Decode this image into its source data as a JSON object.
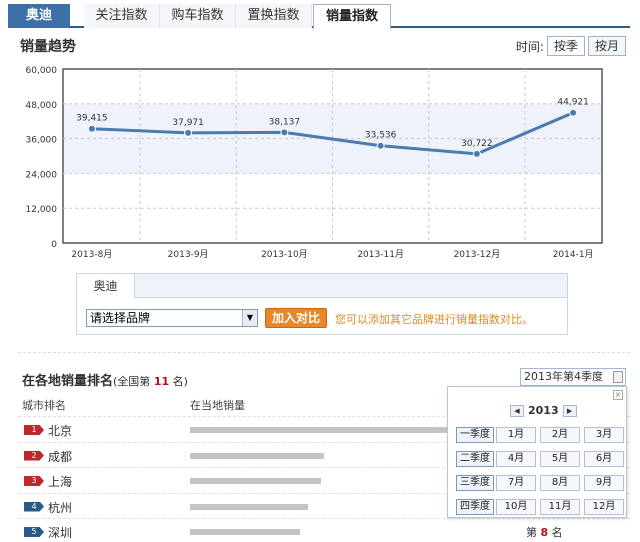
{
  "tabs": {
    "brand": "奥迪",
    "items": [
      "关注指数",
      "购车指数",
      "置换指数",
      "销量指数"
    ],
    "active_index": 3
  },
  "trend": {
    "title": "销量趋势",
    "time_label": "时间:",
    "by_quarter": "按季",
    "by_month": "按月"
  },
  "chart_data": {
    "type": "line",
    "categories": [
      "2013-8月",
      "2013-9月",
      "2013-10月",
      "2013-11月",
      "2013-12月",
      "2014-1月"
    ],
    "series": [
      {
        "values": [
          39415,
          37971,
          38137,
          33536,
          30722,
          44921
        ]
      }
    ],
    "data_labels": [
      "39,415",
      "37,971",
      "38,137",
      "33,536",
      "30,722",
      "44,921"
    ],
    "y_ticks": [
      "0",
      "12,000",
      "24,000",
      "36,000",
      "48,000",
      "60,000"
    ],
    "ylim": [
      0,
      60000
    ],
    "grid": true,
    "colors": {
      "line": "#4a7ab0",
      "band": "#eef3fb",
      "grid": "#c8c8c8"
    }
  },
  "compare": {
    "tab": "奥迪",
    "select_placeholder": "请选择品牌",
    "add_button": "加入对比",
    "hint": "您可以添加其它品牌进行销量指数对比。"
  },
  "ranking": {
    "title": "在各地销量排名",
    "subtitle_prefix": "(全国第",
    "national_rank": "11",
    "subtitle_suffix": "名)",
    "quarter_value": "2013年第4季度",
    "col_city": "城市排名",
    "col_sales": "在当地销量",
    "rows": [
      {
        "rank": "1",
        "city": "北京",
        "share": 0.96
      },
      {
        "rank": "2",
        "city": "成都",
        "share": 0.5
      },
      {
        "rank": "3",
        "city": "上海",
        "share": 0.49
      },
      {
        "rank": "4",
        "city": "杭州",
        "share": 0.44
      },
      {
        "rank": "5",
        "city": "深圳",
        "share": 0.41,
        "rank_prefix": "第",
        "rank_value": "8",
        "rank_suffix": "名"
      }
    ]
  },
  "calendar": {
    "year": "2013",
    "quarters": [
      "一季度",
      "二季度",
      "三季度",
      "四季度"
    ],
    "months": [
      "1月",
      "2月",
      "3月",
      "4月",
      "5月",
      "6月",
      "7月",
      "8月",
      "9月",
      "10月",
      "11月",
      "12月"
    ]
  }
}
